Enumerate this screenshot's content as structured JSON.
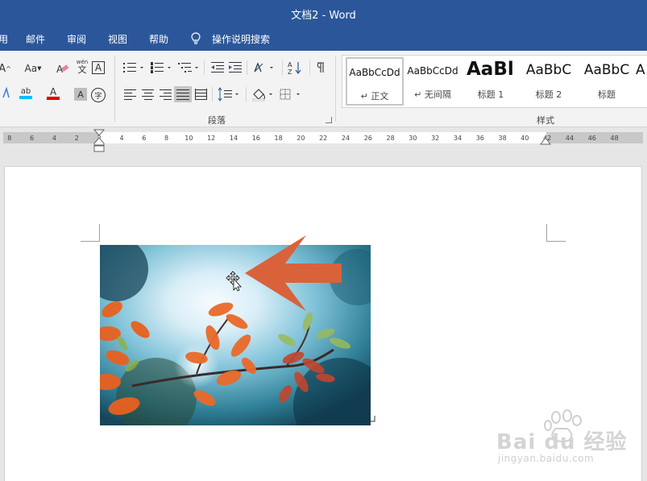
{
  "window": {
    "title": "文档2  -  Word"
  },
  "tabs": [
    "用",
    "邮件",
    "审阅",
    "视图",
    "帮助"
  ],
  "search": {
    "label": "操作说明搜索"
  },
  "ribbon": {
    "font_group": {
      "font_size_up": "A",
      "change_case": "Aa",
      "clear_format": "A",
      "phonetic": "wén",
      "phonetic_char": "文",
      "char_border": "A",
      "font_color": "A",
      "char_shading": "A",
      "enclose_char": "字",
      "highlight": "ab"
    },
    "paragraph_group": {
      "label": "段落"
    },
    "styles_group": {
      "label": "样式",
      "items": [
        {
          "sample": "AaBbCcDd",
          "name": "↵ 正文",
          "selected": true
        },
        {
          "sample": "AaBbCcDd",
          "name": "↵ 无间隔",
          "selected": false
        },
        {
          "sample": "AaBl",
          "name": "标题 1",
          "selected": false
        },
        {
          "sample": "AaBbC",
          "name": "标题 2",
          "selected": false
        },
        {
          "sample": "AaBbC",
          "name": "标题",
          "selected": false
        },
        {
          "sample": "A",
          "name": "",
          "selected": false
        }
      ]
    }
  },
  "ruler": {
    "left_numbers": [
      "8",
      "6",
      "4",
      "2"
    ],
    "right_numbers": [
      "2",
      "4",
      "6",
      "8",
      "10",
      "12",
      "14",
      "16",
      "18",
      "20",
      "22",
      "24",
      "26",
      "28",
      "30",
      "32",
      "34",
      "36",
      "38",
      "40",
      "42",
      "44",
      "46",
      "48"
    ]
  },
  "watermark": {
    "brand": "Bai du 经验",
    "url": "jingyan.baidu.com"
  },
  "colors": {
    "title_bar": "#2b579a",
    "arrow": "#d9623b",
    "font_red": "#e00000",
    "highlight_cyan": "#00c0ff"
  }
}
